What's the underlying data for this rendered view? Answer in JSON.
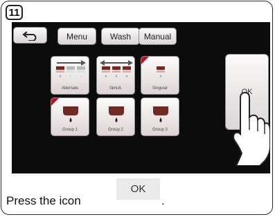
{
  "step_number": "11",
  "top_buttons": {
    "menu": "Menu",
    "wash": "Wash",
    "manual": "Manual"
  },
  "modes": [
    "Alternate",
    "Simult.",
    "Singular"
  ],
  "groups": [
    "Group 1",
    "Group 2",
    "Group 3"
  ],
  "ok_button_label": "OK",
  "instruction": {
    "text": "Press the icon",
    "icon_label": "OK",
    "end": "."
  },
  "colors": {
    "screen_bg": "#0c0c0c",
    "selected_corner": "#b01828",
    "water_drop": "#5aa8dc",
    "cup_icon": "#6e2a24"
  },
  "icons": [
    "back-arrow-icon",
    "hand-pointer-icon",
    "nozzle-icon",
    "water-drop-icon"
  ]
}
